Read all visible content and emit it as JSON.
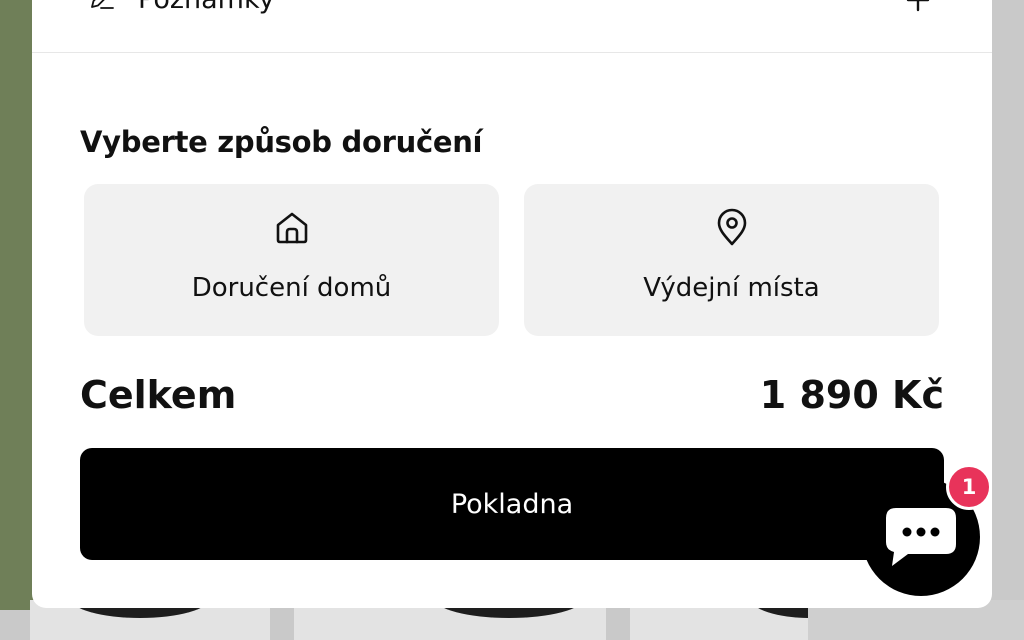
{
  "cart": {
    "notes": {
      "label": "Poznámky",
      "expand_icon": "plus-icon",
      "icon": "pencil-icon"
    },
    "delivery": {
      "title": "Vyberte způsob doručení",
      "options": [
        {
          "label": "Doručení domů",
          "icon": "home-icon"
        },
        {
          "label": "Výdejní místa",
          "icon": "map-pin-icon"
        }
      ]
    },
    "total": {
      "label": "Celkem",
      "value": "1 890 Kč"
    },
    "checkout": {
      "label": "Pokladna"
    }
  },
  "chat": {
    "icon": "chat-bubble-icon",
    "badge_count": "1"
  },
  "colors": {
    "accent": "#000000",
    "badge": "#e8335a",
    "option_bg": "#f1f1f1",
    "background_strip": "#6f7f58"
  }
}
